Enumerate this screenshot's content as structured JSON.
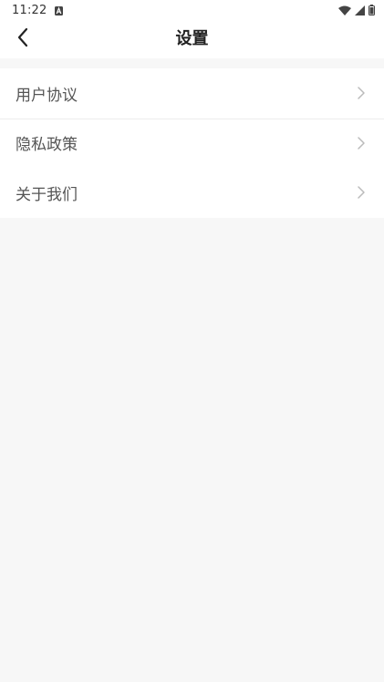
{
  "status_bar": {
    "time": "11:22",
    "notification_icon": "a-box-icon",
    "wifi_icon": "wifi-icon",
    "signal_icon": "cell-signal-icon",
    "battery_icon": "battery-icon"
  },
  "nav": {
    "title": "设置",
    "back_icon": "chevron-left-icon"
  },
  "settings": {
    "items": [
      {
        "label": "用户协议",
        "icon": "chevron-right-icon"
      },
      {
        "label": "隐私政策",
        "icon": "chevron-right-icon"
      },
      {
        "label": "关于我们",
        "icon": "chevron-right-icon"
      }
    ]
  },
  "colors": {
    "background": "#f7f7f7",
    "surface": "#ffffff",
    "title_text": "#222222",
    "item_text": "#555555",
    "chevron": "#bbbbbb",
    "divider": "#ececec"
  }
}
